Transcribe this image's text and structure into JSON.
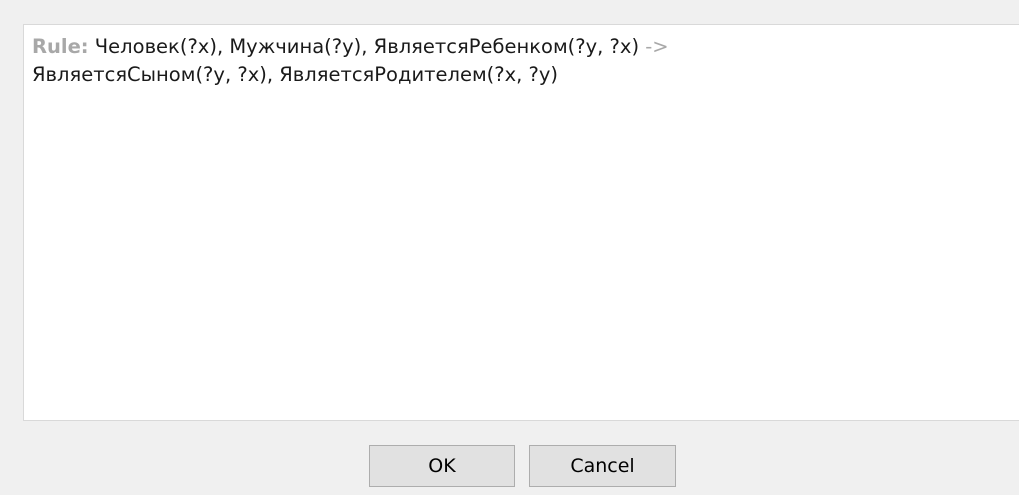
{
  "editor": {
    "rule_keyword": "Rule:",
    "antecedent": " Человек(?x), Мужчина(?y), ЯвляетсяРебенком(?y, ?x) ",
    "arrow": "->",
    "consequent": "ЯвляетсяСыном(?y, ?x), ЯвляетсяРодителем(?x, ?y)"
  },
  "buttons": {
    "ok_label": "OK",
    "cancel_label": "Cancel"
  },
  "colors": {
    "background": "#f0f0f0",
    "editor_background": "#ffffff",
    "keyword": "#a8a8a8",
    "text": "#1a1a1a",
    "button_face": "#e1e1e1",
    "button_border": "#adadad"
  }
}
